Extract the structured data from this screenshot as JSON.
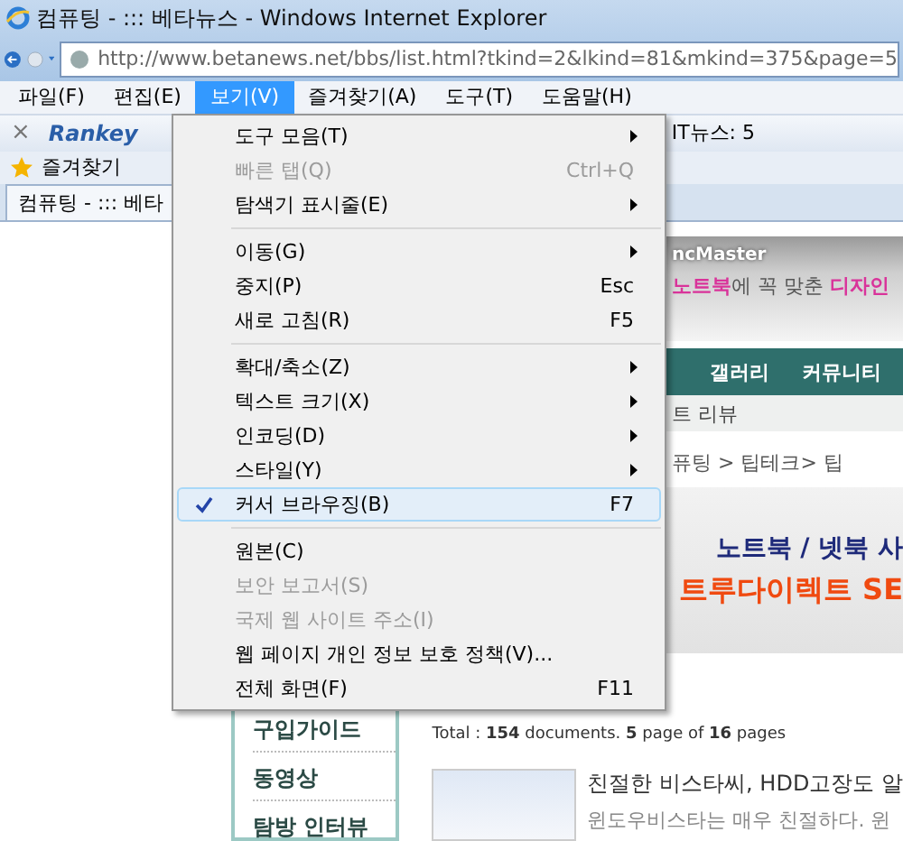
{
  "window": {
    "title": "컴퓨팅 - ::: 베타뉴스 - Windows Internet Explorer"
  },
  "address": {
    "url": "http://www.betanews.net/bbs/list.html?tkind=2&lkind=81&mkind=375&page=5"
  },
  "menubar": [
    {
      "label": "파일(F)",
      "selected": false
    },
    {
      "label": "편집(E)",
      "selected": false
    },
    {
      "label": "보기(V)",
      "selected": true
    },
    {
      "label": "즐겨찾기(A)",
      "selected": false
    },
    {
      "label": "도구(T)",
      "selected": false
    },
    {
      "label": "도움말(H)",
      "selected": false
    }
  ],
  "view_menu": [
    {
      "kind": "item",
      "label": "도구 모음(T)",
      "submenu": true,
      "disabled": false,
      "checked": false
    },
    {
      "kind": "item",
      "label": "빠른 탭(Q)",
      "shortcut": "Ctrl+Q",
      "submenu": false,
      "disabled": true,
      "checked": false
    },
    {
      "kind": "item",
      "label": "탐색기 표시줄(E)",
      "submenu": true,
      "disabled": false,
      "checked": false
    },
    {
      "kind": "separator"
    },
    {
      "kind": "item",
      "label": "이동(G)",
      "submenu": true,
      "disabled": false,
      "checked": false
    },
    {
      "kind": "item",
      "label": "중지(P)",
      "shortcut": "Esc",
      "submenu": false,
      "disabled": false,
      "checked": false
    },
    {
      "kind": "item",
      "label": "새로 고침(R)",
      "shortcut": "F5",
      "submenu": false,
      "disabled": false,
      "checked": false
    },
    {
      "kind": "separator"
    },
    {
      "kind": "item",
      "label": "확대/축소(Z)",
      "submenu": true,
      "disabled": false,
      "checked": false
    },
    {
      "kind": "item",
      "label": "텍스트 크기(X)",
      "submenu": true,
      "disabled": false,
      "checked": false
    },
    {
      "kind": "item",
      "label": "인코딩(D)",
      "submenu": true,
      "disabled": false,
      "checked": false
    },
    {
      "kind": "item",
      "label": "스타일(Y)",
      "submenu": true,
      "disabled": false,
      "checked": false
    },
    {
      "kind": "item",
      "label": "커서 브라우징(B)",
      "shortcut": "F7",
      "submenu": false,
      "disabled": false,
      "checked": true
    },
    {
      "kind": "separator"
    },
    {
      "kind": "item",
      "label": "원본(C)",
      "submenu": false,
      "disabled": false,
      "checked": false
    },
    {
      "kind": "item",
      "label": "보안 보고서(S)",
      "submenu": false,
      "disabled": true,
      "checked": false
    },
    {
      "kind": "item",
      "label": "국제 웹 사이트 주소(I)",
      "submenu": false,
      "disabled": true,
      "checked": false
    },
    {
      "kind": "item",
      "label": "웹 페이지 개인 정보 보호 정책(V)...",
      "submenu": false,
      "disabled": false,
      "checked": false
    },
    {
      "kind": "item",
      "label": "전체 화면(F)",
      "shortcut": "F11",
      "submenu": false,
      "disabled": false,
      "checked": false
    }
  ],
  "toolbar": {
    "close": "×",
    "logo": "Rankey",
    "ticker": "IT뉴스: 5"
  },
  "favorites_bar": {
    "label": "즐겨찾기"
  },
  "tabs": [
    {
      "label": "컴퓨팅 - ::: 베타",
      "selected": true
    }
  ],
  "page": {
    "banner": {
      "brand": "ncMaster",
      "tagline": "**노트북**에 꼭 맞춘 **디자인**"
    },
    "nav": [
      "갤러리",
      "커뮤니티"
    ],
    "subnav": "트 리뷰",
    "breadcrumb": "퓨팅 > 팁테크> 팁",
    "ad": [
      "노트북 / 넷북 사",
      "트루다이렉트 SE"
    ],
    "total": "Total : **154** documents. **5** page of **16** pages",
    "sidebar": [
      "구입가이드",
      "동영상",
      "탐방 인터뷰"
    ],
    "article": {
      "title": "친절한 비스타씨, HDD고장도 알",
      "snippet": "윈도우비스타는 매우 친절하다. 윈"
    }
  }
}
